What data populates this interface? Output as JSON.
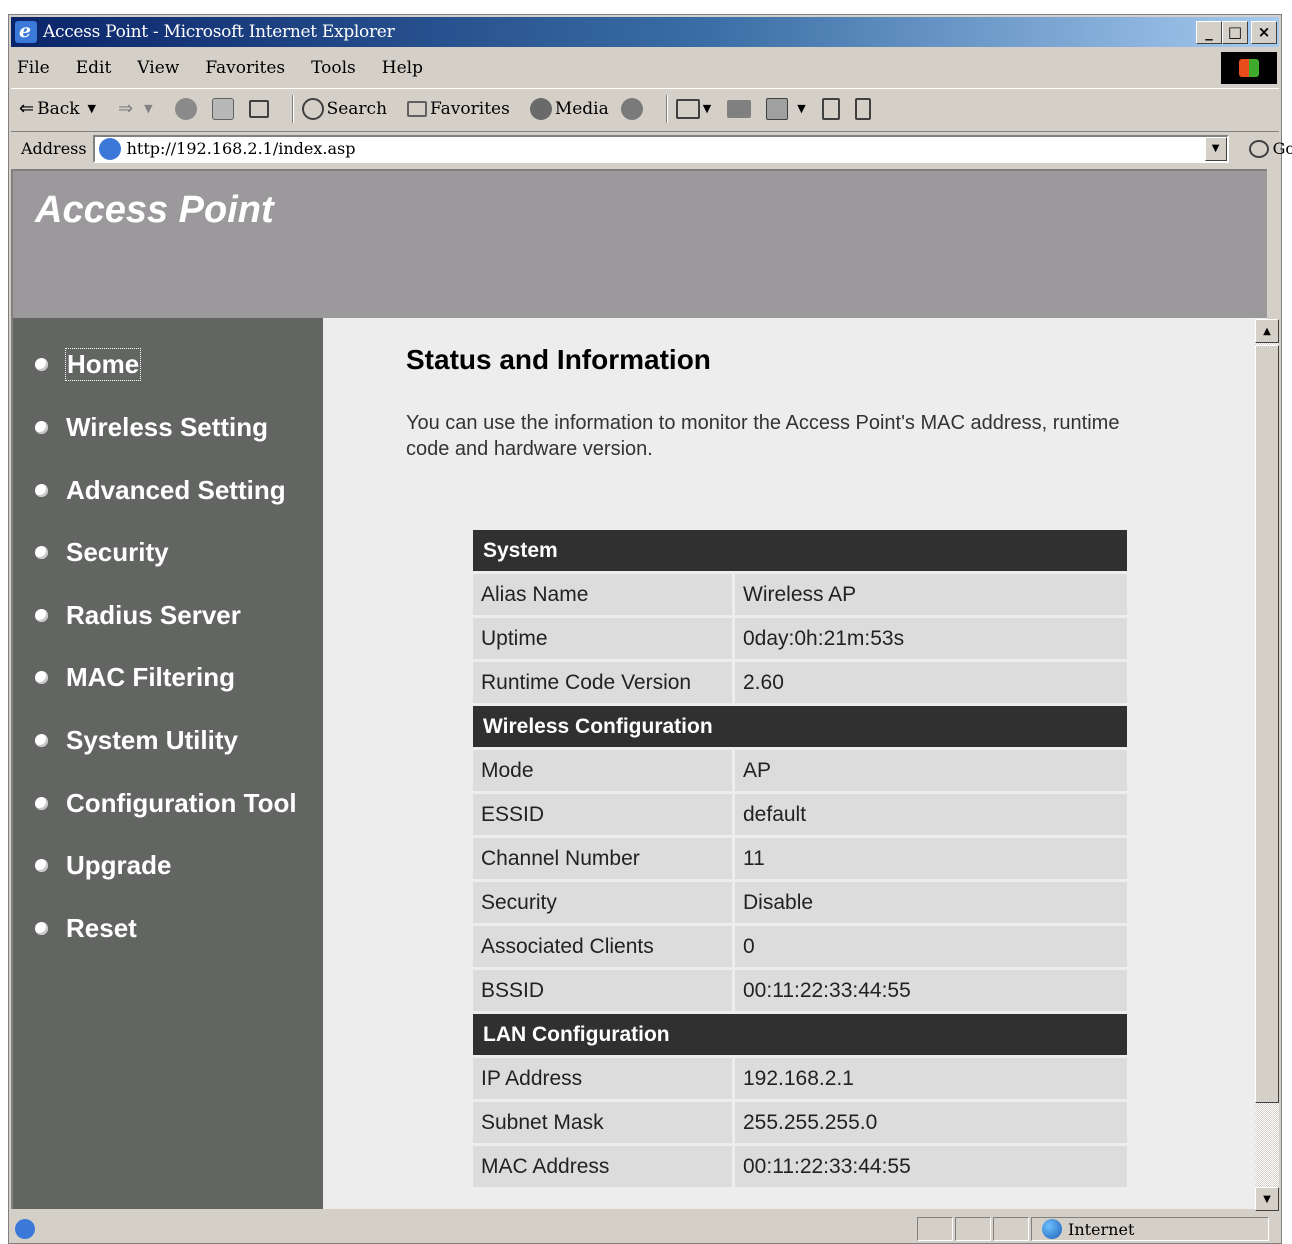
{
  "window": {
    "title": "Access Point - Microsoft Internet Explorer",
    "buttons": {
      "minimize": "_",
      "maximize": "□",
      "close": "×"
    }
  },
  "menu": [
    "File",
    "Edit",
    "View",
    "Favorites",
    "Tools",
    "Help"
  ],
  "toolbar": {
    "back": "Back",
    "search": "Search",
    "favorites": "Favorites",
    "media": "Media"
  },
  "address": {
    "label": "Address",
    "url": "http://192.168.2.1/index.asp",
    "go": "Go"
  },
  "page": {
    "brand": "Access Point",
    "nav": [
      {
        "label": "Home",
        "active": true
      },
      {
        "label": "Wireless Setting"
      },
      {
        "label": "Advanced Setting"
      },
      {
        "label": "Security"
      },
      {
        "label": "Radius Server"
      },
      {
        "label": "MAC Filtering"
      },
      {
        "label": "System Utility"
      },
      {
        "label": "Configuration Tool"
      },
      {
        "label": "Upgrade"
      },
      {
        "label": "Reset"
      }
    ],
    "title": "Status and Information",
    "intro": "You can use the information to monitor the Access Point's MAC address, runtime code and hardware version.",
    "sections": [
      {
        "header": "System",
        "rows": [
          [
            "Alias Name",
            "Wireless AP"
          ],
          [
            "Uptime",
            "0day:0h:21m:53s"
          ],
          [
            "Runtime Code Version",
            "2.60"
          ]
        ]
      },
      {
        "header": "Wireless Configuration",
        "rows": [
          [
            "Mode",
            "AP"
          ],
          [
            "ESSID",
            "default"
          ],
          [
            "Channel Number",
            "11"
          ],
          [
            "Security",
            "Disable"
          ],
          [
            "Associated Clients",
            "0"
          ],
          [
            "BSSID",
            "00:11:22:33:44:55"
          ]
        ]
      },
      {
        "header": "LAN Configuration",
        "rows": [
          [
            "IP Address",
            "192.168.2.1"
          ],
          [
            "Subnet Mask",
            "255.255.255.0"
          ],
          [
            "MAC Address",
            "00:11:22:33:44:55"
          ]
        ]
      }
    ]
  },
  "status": {
    "zone": "Internet"
  },
  "colors": {
    "banner": "#9c999c",
    "sidebar": "#636563",
    "section_header": "#313031",
    "row": "#dcdcdc",
    "content_bg": "#ededed"
  }
}
